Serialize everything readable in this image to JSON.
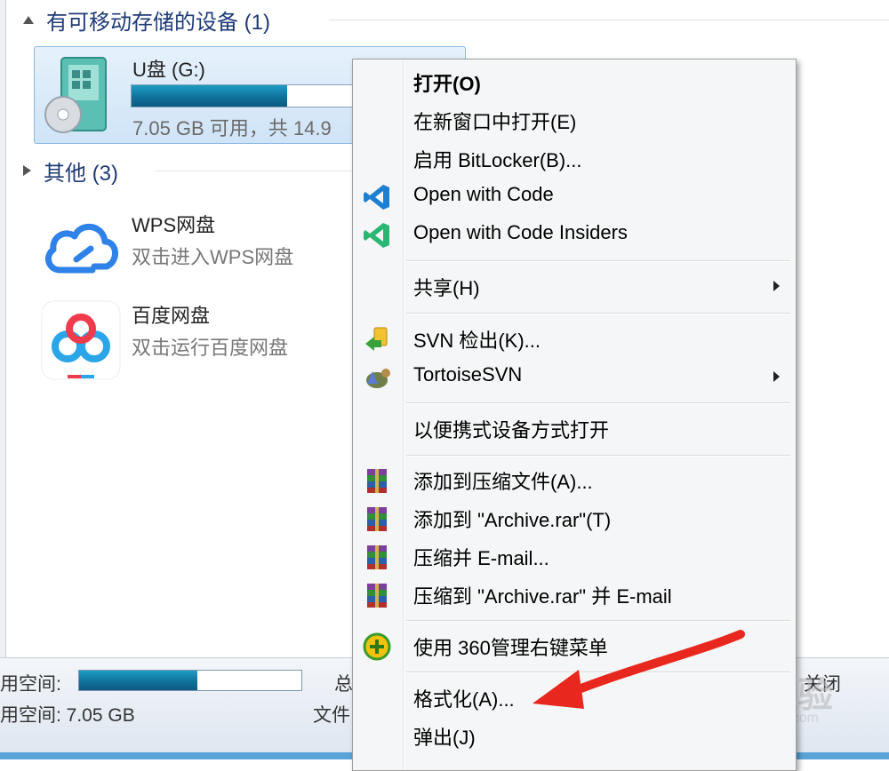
{
  "removable": {
    "header": "有可移动存储的设备 (1)",
    "drive": {
      "name": "U盘 (G:)",
      "free_text": "7.05 GB 可用，共 14.9",
      "used_fraction": 0.53
    }
  },
  "other": {
    "header": "其他 (3)",
    "items": [
      {
        "name": "WPS网盘",
        "desc": "双击进入WPS网盘",
        "icon": "wps-cloud-icon"
      },
      {
        "name": "百度网盘",
        "desc": "双击运行百度网盘",
        "icon": "baidu-netdisk-icon"
      }
    ]
  },
  "status_bar": {
    "used_label": "用空间:",
    "free_label": "用空间: 7.05 GB",
    "total_label": "总",
    "fs_label": "文件",
    "close_label": "关闭",
    "used_fraction": 0.53
  },
  "context_menu": {
    "items": [
      {
        "label": "打开(O)",
        "bold": true
      },
      {
        "label": "在新窗口中打开(E)"
      },
      {
        "label": "启用 BitLocker(B)..."
      },
      {
        "label": "Open with Code",
        "icon": "vscode-icon"
      },
      {
        "label": "Open with Code Insiders",
        "icon": "vscode-insiders-icon"
      },
      {
        "label": "共享(H)",
        "submenu": true
      },
      {
        "label": "SVN 检出(K)...",
        "icon": "svn-checkout-icon"
      },
      {
        "label": "TortoiseSVN",
        "icon": "tortoisesvn-icon",
        "submenu": true
      },
      {
        "label": "以便携式设备方式打开"
      },
      {
        "label": "添加到压缩文件(A)...",
        "icon": "winrar-icon"
      },
      {
        "label": "添加到 \"Archive.rar\"(T)",
        "icon": "winrar-icon"
      },
      {
        "label": "压缩并 E-mail...",
        "icon": "winrar-icon"
      },
      {
        "label": "压缩到 \"Archive.rar\" 并 E-mail",
        "icon": "winrar-icon"
      },
      {
        "label": "使用 360管理右键菜单",
        "icon": "360-icon"
      },
      {
        "label": "格式化(A)..."
      },
      {
        "label": "弹出(J)"
      }
    ]
  },
  "watermark": {
    "brand": "Bai 经验",
    "url": "jingyan.baidu.com"
  },
  "colors": {
    "accent": "#0f6e97",
    "annotation_arrow": "#e8281e",
    "header_text": "#1e3a78"
  }
}
